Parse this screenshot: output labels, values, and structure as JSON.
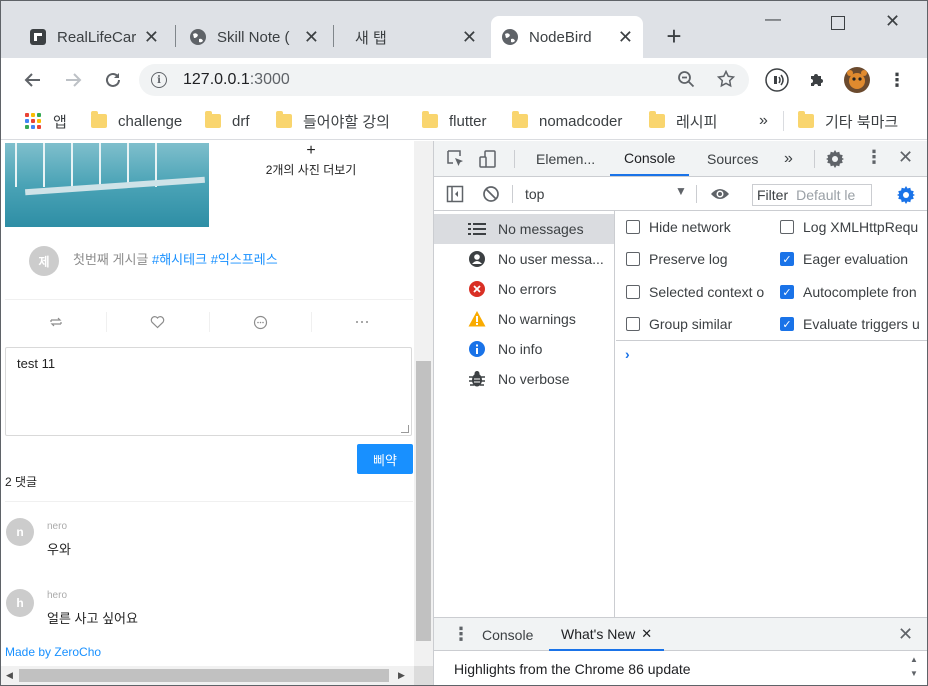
{
  "browser": {
    "tabs": [
      {
        "title": "RealLifeCar",
        "active": false
      },
      {
        "title": "Skill Note (",
        "active": false
      },
      {
        "title": "새 탭",
        "active": false
      },
      {
        "title": "NodeBird",
        "active": true
      }
    ],
    "url_host": "127.0.0.1",
    "url_port": ":3000",
    "bookmarks": [
      "앱",
      "challenge",
      "drf",
      "들어야할 강의",
      "flutter",
      "nomadcoder",
      "레시피"
    ],
    "bookmarks_overflow": "»",
    "other_bookmarks": "기타 북마크"
  },
  "page": {
    "more_photos_plus": "+",
    "more_photos_label": "2개의 사진 더보기",
    "post": {
      "author_initial": "제",
      "text_plain": "첫번째 게시글 ",
      "hashtag1": "#해시테크",
      "hashtag2": "#익스프레스"
    },
    "comment_input_value": "test 11",
    "submit_label": "삐약",
    "comment_count_label": "2 댓글",
    "comments": [
      {
        "initial": "n",
        "author": "nero",
        "text": "우와"
      },
      {
        "initial": "h",
        "author": "hero",
        "text": "얼른 사고 싶어요"
      }
    ],
    "footer_link": "Made by ZeroCho"
  },
  "devtools": {
    "tabs": [
      "Elemen...",
      "Console",
      "Sources"
    ],
    "active_tab": "Console",
    "overflow": "»",
    "context": "top",
    "filter_label": "Filter",
    "filter_placeholder": "Default le",
    "sidebar": [
      {
        "label": "No messages",
        "icon": "list-icon"
      },
      {
        "label": "No user messa...",
        "icon": "user-icon"
      },
      {
        "label": "No errors",
        "icon": "error-icon"
      },
      {
        "label": "No warnings",
        "icon": "warning-icon"
      },
      {
        "label": "No info",
        "icon": "info-icon"
      },
      {
        "label": "No verbose",
        "icon": "bug-icon"
      }
    ],
    "settings": {
      "hide_network": {
        "label": "Hide network",
        "checked": false
      },
      "preserve_log": {
        "label": "Preserve log",
        "checked": false
      },
      "selected_context": {
        "label": "Selected context o",
        "checked": false
      },
      "group_similar": {
        "label": "Group similar",
        "checked": false
      },
      "log_xhr": {
        "label": "Log XMLHttpRequ",
        "checked": false
      },
      "eager_eval": {
        "label": "Eager evaluation",
        "checked": true
      },
      "autocomplete": {
        "label": "Autocomplete fron",
        "checked": true
      },
      "evaluate_triggers": {
        "label": "Evaluate triggers u",
        "checked": true
      }
    },
    "prompt": "›",
    "drawer_tabs": [
      "Console",
      "What's New"
    ],
    "drawer_active": "What's New",
    "drawer_content": "Highlights from the Chrome 86 update"
  },
  "colors": {
    "accent_blue": "#1a73e8",
    "antd_blue": "#1890ff",
    "tab_strip": "#dee1e6"
  }
}
